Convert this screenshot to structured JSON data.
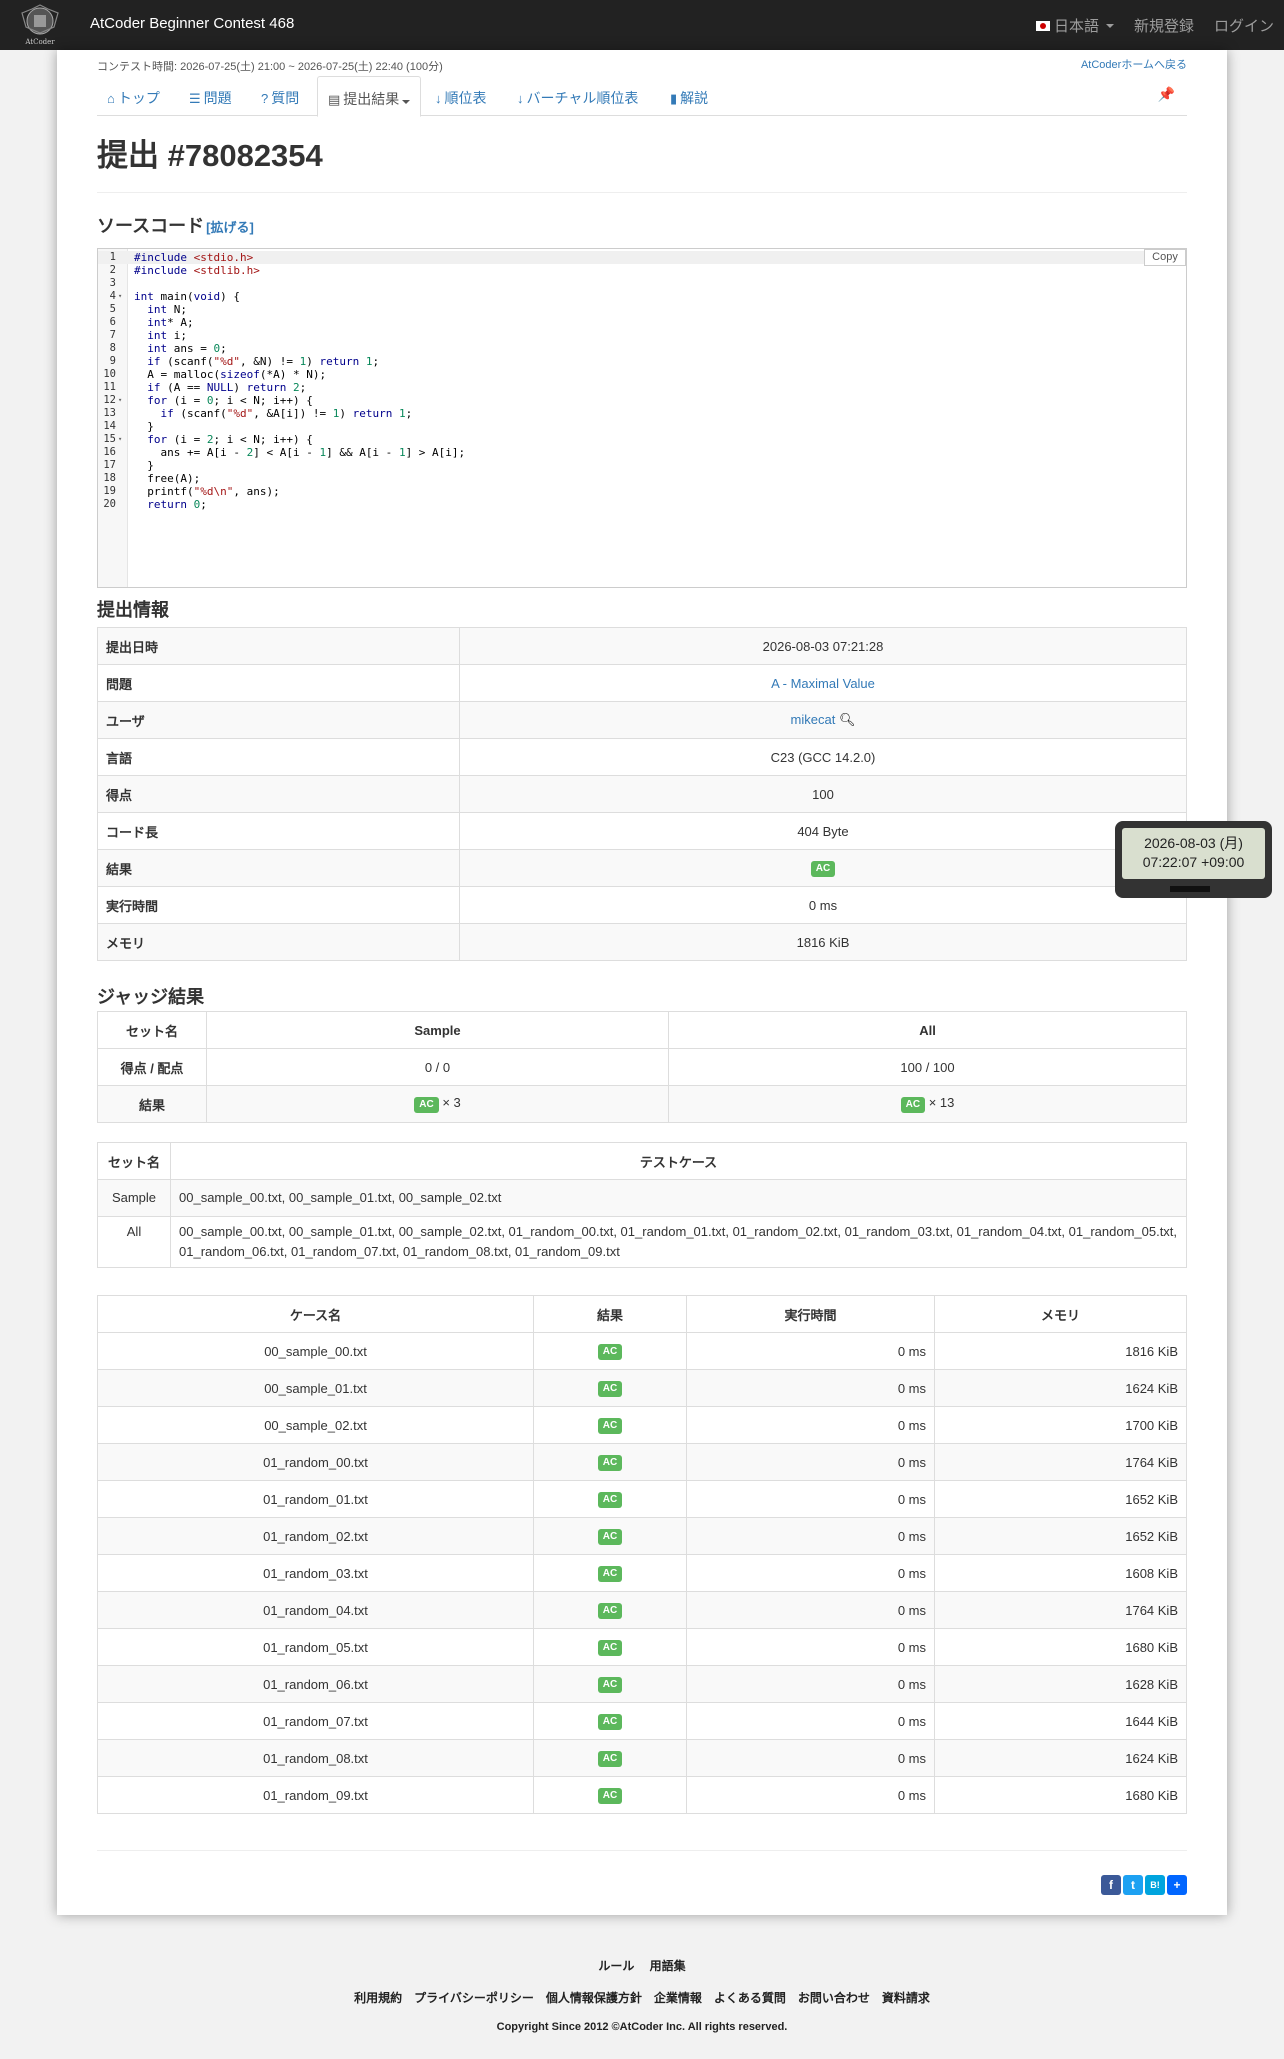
{
  "navbar": {
    "brand": "AtCoder Beginner Contest 468",
    "logo_text": "AtCoder",
    "language": "日本語",
    "register": "新規登録",
    "login": "ログイン"
  },
  "contest": {
    "time": "コンテスト時間: 2026-07-25(土) 21:00 ~ 2026-07-25(土) 22:40 (100分)",
    "home_link": "AtCoderホームへ戻る"
  },
  "tabs": [
    {
      "label": "トップ",
      "icon": "home-icon"
    },
    {
      "label": "問題",
      "icon": "list-icon"
    },
    {
      "label": "質問",
      "icon": "question-icon"
    },
    {
      "label": "提出結果",
      "icon": "table-icon"
    },
    {
      "label": "順位表",
      "icon": "sort-icon"
    },
    {
      "label": "バーチャル順位表",
      "icon": "sort-icon"
    },
    {
      "label": "解説",
      "icon": "book-icon"
    }
  ],
  "submission": {
    "title": "提出 #78082354"
  },
  "source": {
    "heading": "ソースコード",
    "expand": "[拡げる]",
    "copy": "Copy",
    "lines": [
      "#include <stdio.h>",
      "#include <stdlib.h>",
      "",
      "int main(void) {",
      "  int N;",
      "  int* A;",
      "  int i;",
      "  int ans = 0;",
      "  if (scanf(\"%d\", &N) != 1) return 1;",
      "  A = malloc(sizeof(*A) * N);",
      "  if (A == NULL) return 2;",
      "  for (i = 0; i < N; i++) {",
      "    if (scanf(\"%d\", &A[i]) != 1) return 1;",
      "  }",
      "  for (i = 2; i < N; i++) {",
      "    ans += A[i - 2] < A[i - 1] && A[i - 1] > A[i];",
      "  }",
      "  free(A);",
      "  printf(\"%d\\n\", ans);",
      "  return 0;"
    ]
  },
  "info": {
    "heading": "提出情報",
    "rows": [
      {
        "label": "提出日時",
        "value": "2026-08-03 07:21:28"
      },
      {
        "label": "問題",
        "value": "A - Maximal Value"
      },
      {
        "label": "ユーザ",
        "value": "mikecat"
      },
      {
        "label": "言語",
        "value": "C23 (GCC 14.2.0)"
      },
      {
        "label": "得点",
        "value": "100"
      },
      {
        "label": "コード長",
        "value": "404 Byte"
      },
      {
        "label": "結果",
        "value": "AC"
      },
      {
        "label": "実行時間",
        "value": "0 ms"
      },
      {
        "label": "メモリ",
        "value": "1816 KiB"
      }
    ]
  },
  "judge": {
    "heading": "ジャッジ結果",
    "header": [
      "セット名",
      "Sample",
      "All"
    ],
    "score_label": "得点 / 配点",
    "score_sample": "0 / 0",
    "score_all": "100 / 100",
    "result_label": "結果",
    "result_badge": "AC",
    "result_sample": "× 3",
    "result_all": "× 13"
  },
  "sets": {
    "header": [
      "セット名",
      "テストケース"
    ],
    "rows": [
      {
        "name": "Sample",
        "cases": "00_sample_00.txt, 00_sample_01.txt, 00_sample_02.txt"
      },
      {
        "name": "All",
        "cases": "00_sample_00.txt, 00_sample_01.txt, 00_sample_02.txt, 01_random_00.txt, 01_random_01.txt, 01_random_02.txt, 01_random_03.txt, 01_random_04.txt, 01_random_05.txt, 01_random_06.txt, 01_random_07.txt, 01_random_08.txt, 01_random_09.txt"
      }
    ]
  },
  "cases": {
    "header": [
      "ケース名",
      "結果",
      "実行時間",
      "メモリ"
    ],
    "rows": [
      {
        "name": "00_sample_00.txt",
        "status": "AC",
        "time": "0 ms",
        "memory": "1816 KiB"
      },
      {
        "name": "00_sample_01.txt",
        "status": "AC",
        "time": "0 ms",
        "memory": "1624 KiB"
      },
      {
        "name": "00_sample_02.txt",
        "status": "AC",
        "time": "0 ms",
        "memory": "1700 KiB"
      },
      {
        "name": "01_random_00.txt",
        "status": "AC",
        "time": "0 ms",
        "memory": "1764 KiB"
      },
      {
        "name": "01_random_01.txt",
        "status": "AC",
        "time": "0 ms",
        "memory": "1652 KiB"
      },
      {
        "name": "01_random_02.txt",
        "status": "AC",
        "time": "0 ms",
        "memory": "1652 KiB"
      },
      {
        "name": "01_random_03.txt",
        "status": "AC",
        "time": "0 ms",
        "memory": "1608 KiB"
      },
      {
        "name": "01_random_04.txt",
        "status": "AC",
        "time": "0 ms",
        "memory": "1764 KiB"
      },
      {
        "name": "01_random_05.txt",
        "status": "AC",
        "time": "0 ms",
        "memory": "1680 KiB"
      },
      {
        "name": "01_random_06.txt",
        "status": "AC",
        "time": "0 ms",
        "memory": "1628 KiB"
      },
      {
        "name": "01_random_07.txt",
        "status": "AC",
        "time": "0 ms",
        "memory": "1644 KiB"
      },
      {
        "name": "01_random_08.txt",
        "status": "AC",
        "time": "0 ms",
        "memory": "1624 KiB"
      },
      {
        "name": "01_random_09.txt",
        "status": "AC",
        "time": "0 ms",
        "memory": "1680 KiB"
      }
    ]
  },
  "tooltip": {
    "line1": "2026-08-03 (月)",
    "line2": "07:22:07 +09:00"
  },
  "share": [
    "f",
    "t",
    "B!",
    "+"
  ],
  "footer": {
    "row1": [
      "ルール",
      "用語集"
    ],
    "row2": [
      "利用規約",
      "プライバシーポリシー",
      "個人情報保護方針",
      "企業情報",
      "よくある質問",
      "お問い合わせ",
      "資料請求"
    ],
    "copyright": "Copyright Since 2012 ©AtCoder Inc. All rights reserved."
  },
  "colors": {
    "navbar": "#222222",
    "link": "#337ab7",
    "ac": "#5cb85c"
  }
}
